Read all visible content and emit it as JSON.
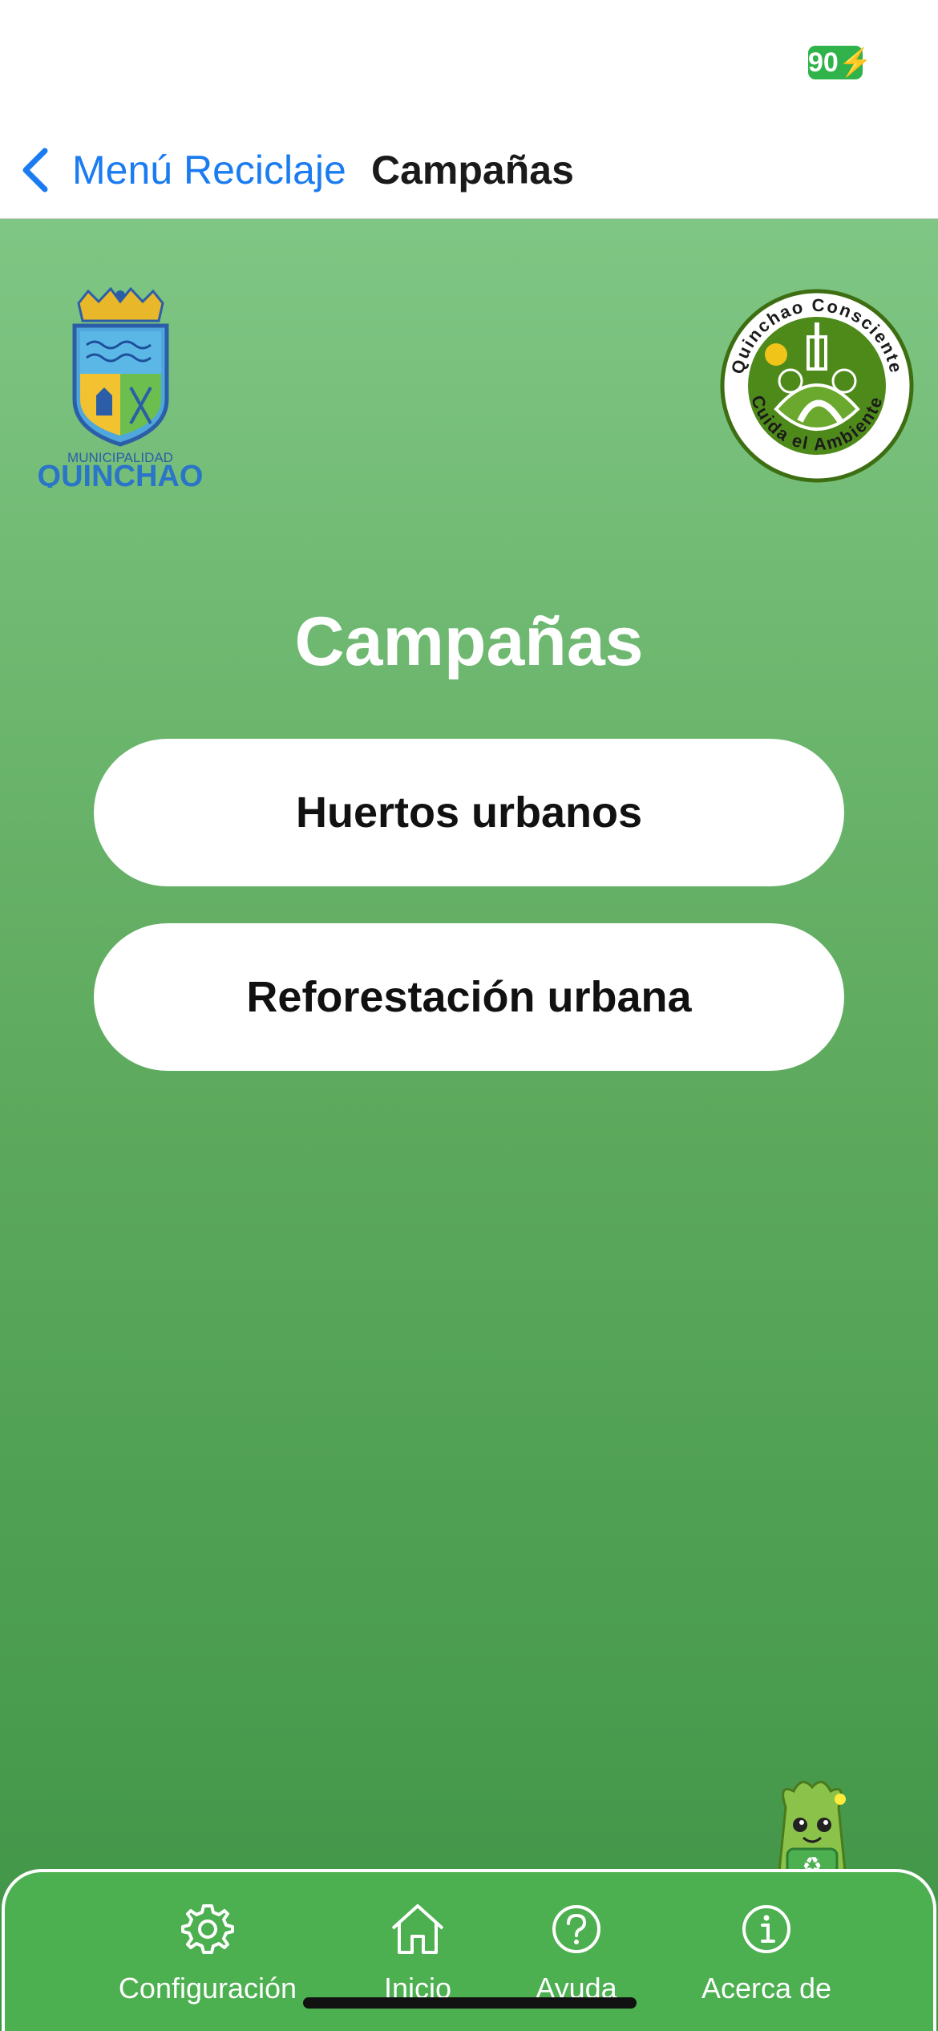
{
  "status_bar": {
    "battery": "90"
  },
  "nav": {
    "back_label": "Menú Reciclaje",
    "title": "Campañas"
  },
  "logos": {
    "municipal_line1": "MUNICIPALIDAD",
    "municipal_line2": "QUINCHAO",
    "consciente_top": "Quinchao Consciente",
    "consciente_bottom": "Cuida el Ambiente"
  },
  "main": {
    "title": "Campañas",
    "buttons": [
      {
        "label": "Huertos urbanos"
      },
      {
        "label": "Reforestación urbana"
      }
    ]
  },
  "tab_bar": {
    "items": [
      {
        "label": "Configuración",
        "icon": "gear-icon"
      },
      {
        "label": "Inicio",
        "icon": "home-icon"
      },
      {
        "label": "Ayuda",
        "icon": "help-icon"
      },
      {
        "label": "Acerca de",
        "icon": "info-icon"
      }
    ]
  },
  "colors": {
    "accent": "#1a7cf0",
    "gradient_top": "#7fc684",
    "gradient_bottom": "#3f9446",
    "tab_bar": "#4caf50",
    "battery": "#2fb34a"
  }
}
